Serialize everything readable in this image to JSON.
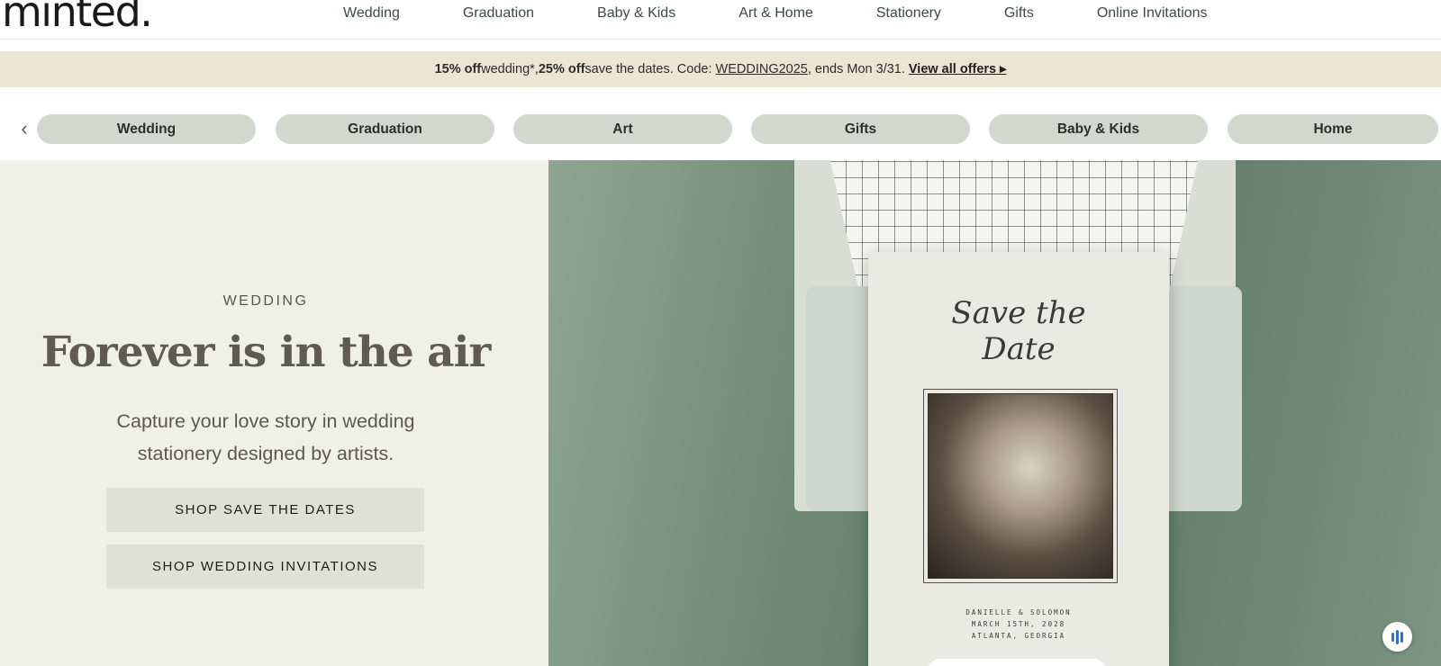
{
  "header": {
    "logo": "minted.",
    "nav": [
      "Wedding",
      "Graduation",
      "Baby & Kids",
      "Art & Home",
      "Stationery",
      "Gifts",
      "Online Invitations"
    ]
  },
  "promo": {
    "part1_bold": "15% off",
    "part1": " wedding*,",
    "part2_bold": " 25% off",
    "part2": " save the dates. Code:",
    "code": "WEDDING2025",
    "part3": ", ends Mon 3/31.",
    "link": "View all offers ▸"
  },
  "pills": {
    "prev_icon": "‹",
    "items": [
      "Wedding",
      "Graduation",
      "Art",
      "Gifts",
      "Baby & Kids",
      "Home"
    ]
  },
  "hero": {
    "eyebrow": "WEDDING",
    "headline": "Forever is in the air",
    "subhead": "Capture your love story in wedding stationery designed by artists.",
    "cta_primary": "SHOP SAVE THE DATES",
    "cta_secondary": "SHOP WEDDING INVITATIONS"
  },
  "card": {
    "script_line1": "Save the",
    "script_line2": "Date",
    "names": "DANIELLE & SOLOMON",
    "date": "MARCH 15TH, 2028",
    "place": "ATLANTA, GEORGIA"
  },
  "icons": {
    "prev": "chevron-left-icon",
    "assistant": "voice-assistant-icon"
  },
  "colors": {
    "promo_bg": "#ebe5d3",
    "pill_bg": "#d2d8d0",
    "hero_left_bg": "#eff1e7",
    "hero_right_bg": "#6f8a75",
    "assistant_accent": "#2f6fd6"
  }
}
